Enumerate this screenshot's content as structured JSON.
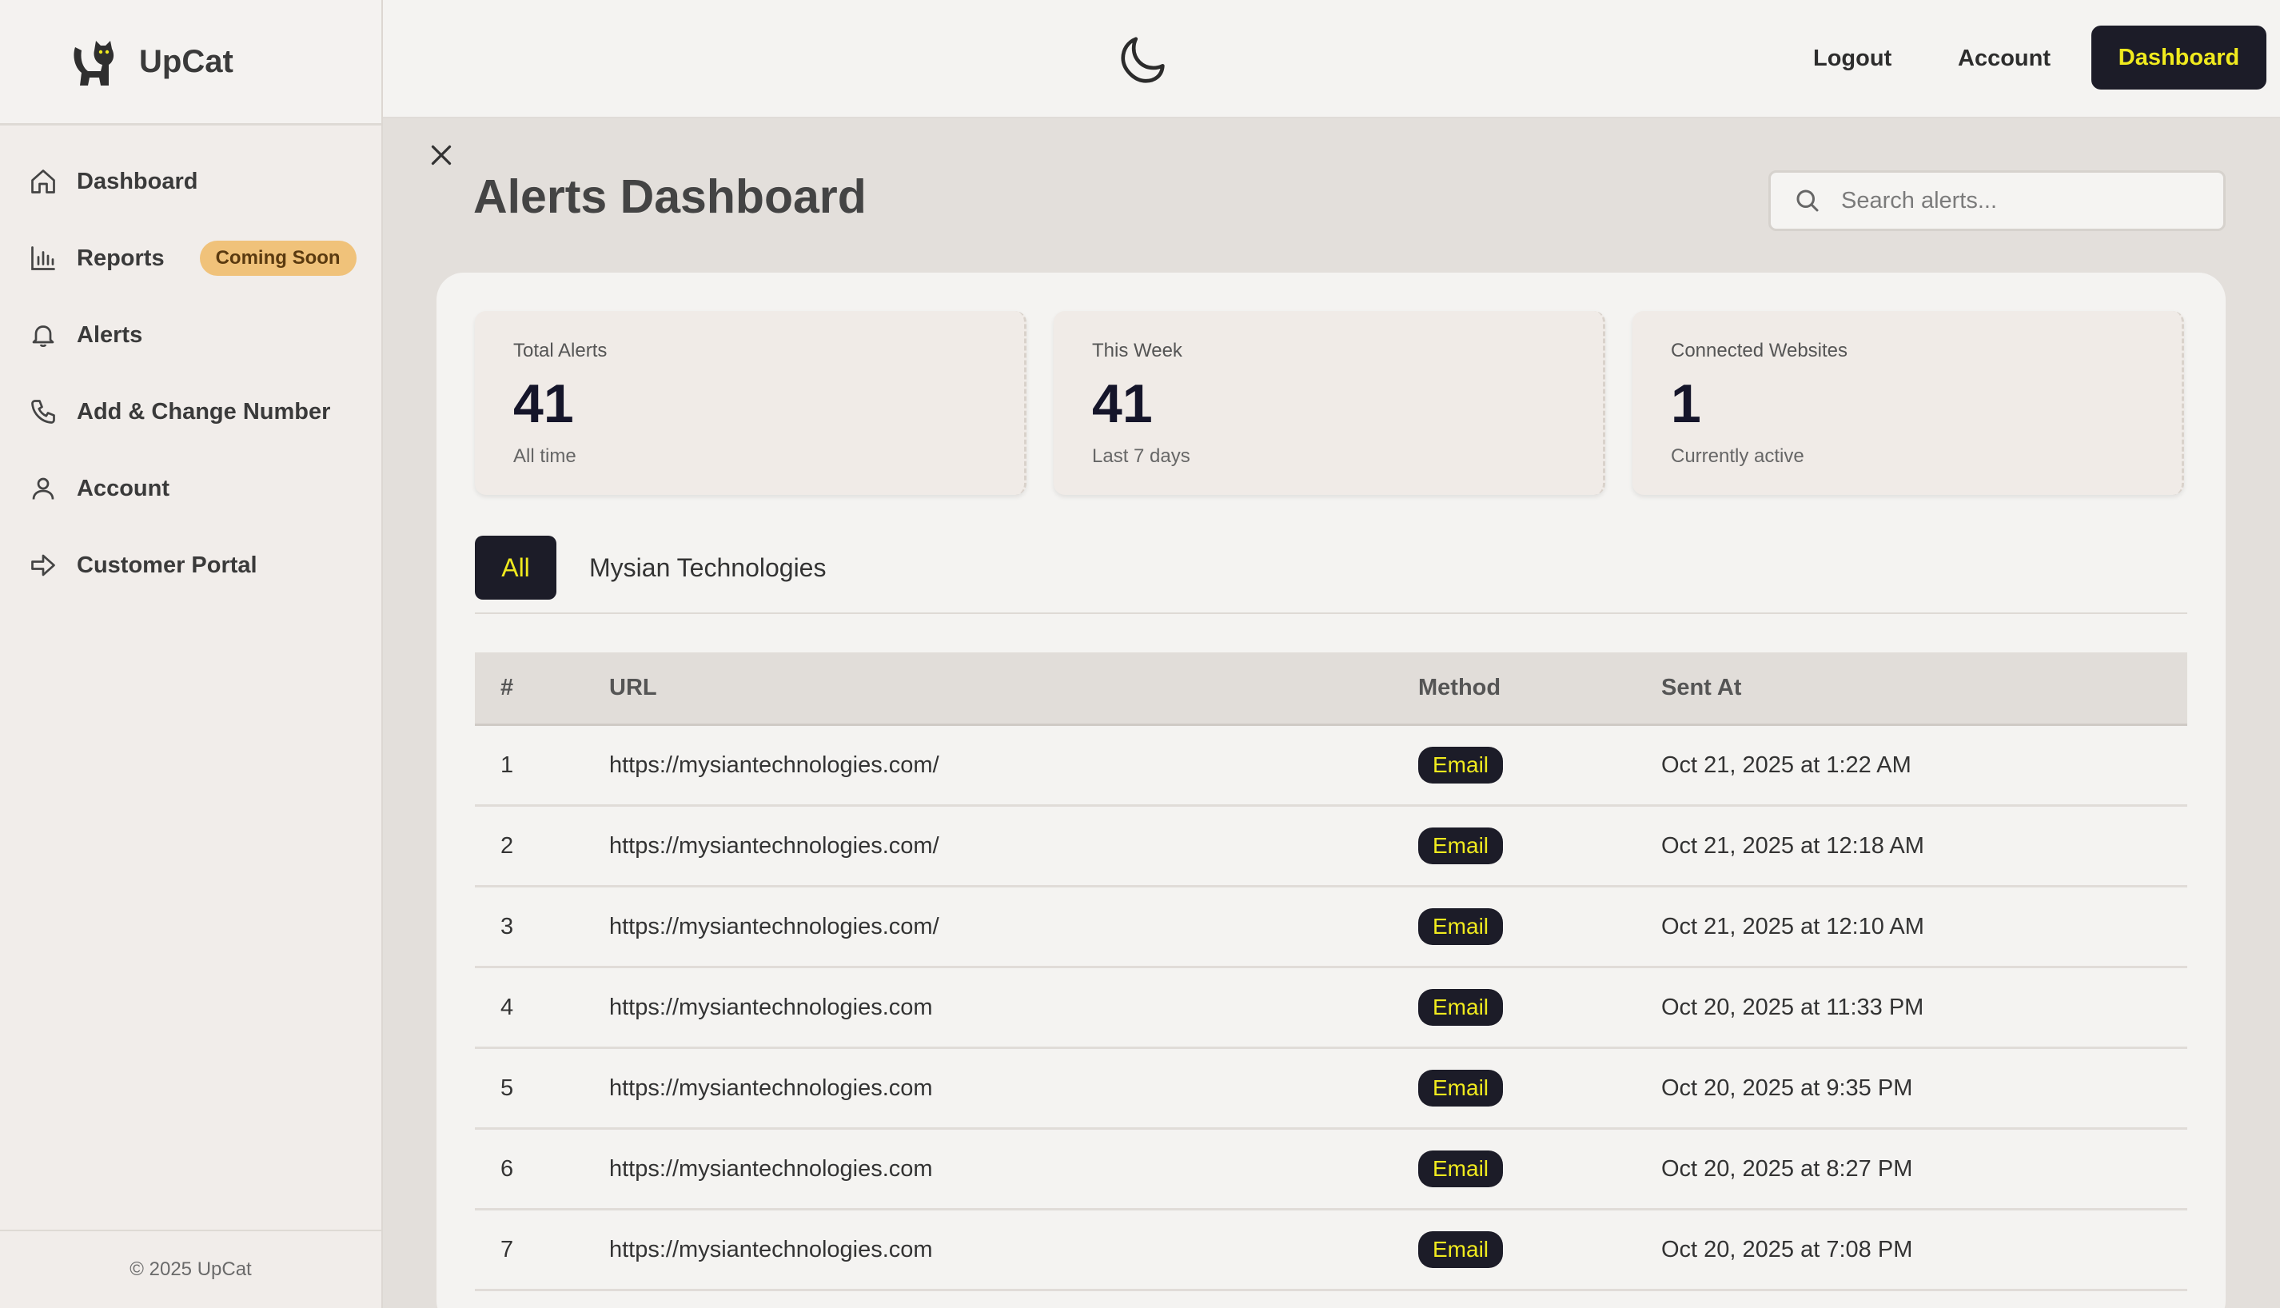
{
  "brand": {
    "name": "UpCat"
  },
  "sidebar": {
    "items": [
      {
        "label": "Dashboard",
        "icon": "home-icon"
      },
      {
        "label": "Reports",
        "icon": "bar-chart-icon",
        "badge": "Coming Soon"
      },
      {
        "label": "Alerts",
        "icon": "bell-icon"
      },
      {
        "label": "Add & Change Number",
        "icon": "phone-icon"
      },
      {
        "label": "Account",
        "icon": "user-icon"
      },
      {
        "label": "Customer Portal",
        "icon": "arrow-right-icon"
      }
    ],
    "footer": "© 2025 UpCat"
  },
  "topbar": {
    "theme_icon": "moon-icon",
    "logout": "Logout",
    "account": "Account",
    "dashboard": "Dashboard"
  },
  "main": {
    "title": "Alerts Dashboard",
    "search": {
      "placeholder": "Search alerts..."
    },
    "stats": [
      {
        "title": "Total Alerts",
        "value": "41",
        "sub": "All time"
      },
      {
        "title": "This Week",
        "value": "41",
        "sub": "Last 7 days"
      },
      {
        "title": "Connected Websites",
        "value": "1",
        "sub": "Currently active"
      }
    ],
    "tabs": [
      "All",
      "Mysian Technologies"
    ],
    "table": {
      "headers": [
        "#",
        "URL",
        "Method",
        "Sent At"
      ],
      "rows": [
        {
          "n": "1",
          "url": "https://mysiantechnologies.com/",
          "method": "Email",
          "sent": "Oct 21, 2025 at 1:22 AM"
        },
        {
          "n": "2",
          "url": "https://mysiantechnologies.com/",
          "method": "Email",
          "sent": "Oct 21, 2025 at 12:18 AM"
        },
        {
          "n": "3",
          "url": "https://mysiantechnologies.com/",
          "method": "Email",
          "sent": "Oct 21, 2025 at 12:10 AM"
        },
        {
          "n": "4",
          "url": "https://mysiantechnologies.com",
          "method": "Email",
          "sent": "Oct 20, 2025 at 11:33 PM"
        },
        {
          "n": "5",
          "url": "https://mysiantechnologies.com",
          "method": "Email",
          "sent": "Oct 20, 2025 at 9:35 PM"
        },
        {
          "n": "6",
          "url": "https://mysiantechnologies.com",
          "method": "Email",
          "sent": "Oct 20, 2025 at 8:27 PM"
        },
        {
          "n": "7",
          "url": "https://mysiantechnologies.com",
          "method": "Email",
          "sent": "Oct 20, 2025 at 7:08 PM"
        }
      ]
    }
  },
  "colors": {
    "accent": "#f0ea1e",
    "dark": "#1c1c28",
    "badge": "#f0c27a"
  }
}
